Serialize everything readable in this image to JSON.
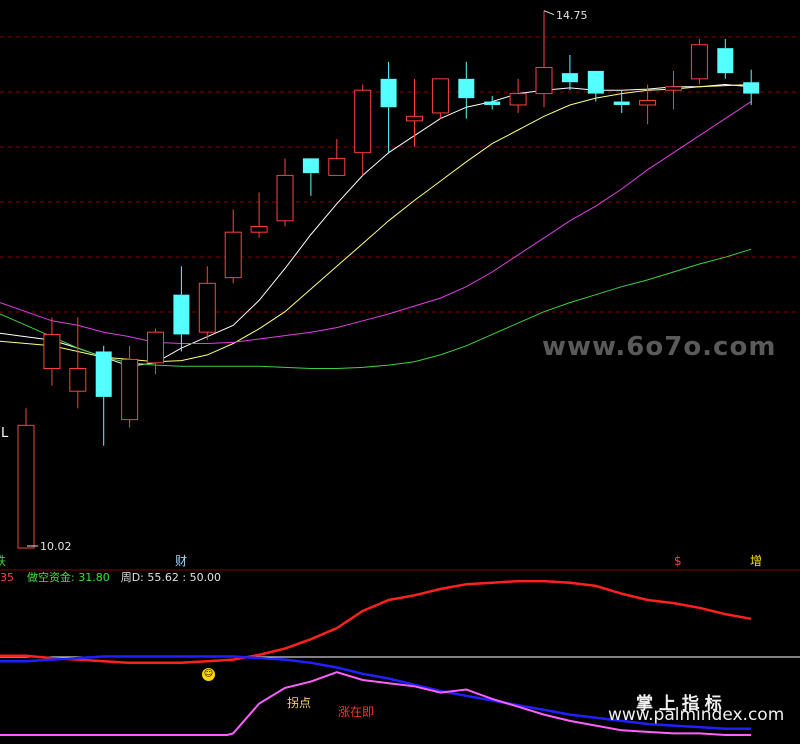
{
  "chart_data": {
    "type": "candlestick",
    "price_panel": {
      "high_label": "14.75",
      "low_label": "10.02",
      "candles": [
        {
          "o": 10.02,
          "h": 11.25,
          "l": 10.02,
          "c": 11.1,
          "color": "red"
        },
        {
          "o": 11.6,
          "h": 12.05,
          "l": 11.45,
          "c": 11.9,
          "color": "red"
        },
        {
          "o": 11.4,
          "h": 12.05,
          "l": 11.25,
          "c": 11.6,
          "color": "red"
        },
        {
          "o": 11.75,
          "h": 11.8,
          "l": 10.92,
          "c": 11.35,
          "color": "cyan"
        },
        {
          "o": 11.15,
          "h": 11.8,
          "l": 11.08,
          "c": 11.68,
          "color": "red"
        },
        {
          "o": 11.65,
          "h": 11.95,
          "l": 11.55,
          "c": 11.92,
          "color": "red"
        },
        {
          "o": 12.25,
          "h": 12.5,
          "l": 11.75,
          "c": 11.9,
          "color": "cyan"
        },
        {
          "o": 11.92,
          "h": 12.5,
          "l": 11.85,
          "c": 12.35,
          "color": "red"
        },
        {
          "o": 12.4,
          "h": 13.0,
          "l": 12.35,
          "c": 12.8,
          "color": "red"
        },
        {
          "o": 12.8,
          "h": 13.15,
          "l": 12.75,
          "c": 12.85,
          "color": "red"
        },
        {
          "o": 12.9,
          "h": 13.45,
          "l": 12.85,
          "c": 13.3,
          "color": "red"
        },
        {
          "o": 13.45,
          "h": 13.45,
          "l": 13.12,
          "c": 13.32,
          "color": "cyan"
        },
        {
          "o": 13.3,
          "h": 13.62,
          "l": 13.3,
          "c": 13.45,
          "color": "red"
        },
        {
          "o": 13.5,
          "h": 14.1,
          "l": 13.3,
          "c": 14.05,
          "color": "red"
        },
        {
          "o": 14.15,
          "h": 14.3,
          "l": 13.5,
          "c": 13.9,
          "color": "cyan"
        },
        {
          "o": 13.78,
          "h": 14.15,
          "l": 13.55,
          "c": 13.82,
          "color": "red"
        },
        {
          "o": 13.85,
          "h": 14.15,
          "l": 13.8,
          "c": 14.15,
          "color": "red"
        },
        {
          "o": 14.15,
          "h": 14.3,
          "l": 13.8,
          "c": 13.98,
          "color": "cyan"
        },
        {
          "o": 13.95,
          "h": 14.0,
          "l": 13.88,
          "c": 13.92,
          "color": "cyan"
        },
        {
          "o": 13.92,
          "h": 14.15,
          "l": 13.85,
          "c": 14.02,
          "color": "red"
        },
        {
          "o": 14.02,
          "h": 14.75,
          "l": 13.9,
          "c": 14.25,
          "color": "red"
        },
        {
          "o": 14.2,
          "h": 14.36,
          "l": 14.05,
          "c": 14.12,
          "color": "cyan"
        },
        {
          "o": 14.22,
          "h": 14.22,
          "l": 13.95,
          "c": 14.02,
          "color": "cyan"
        },
        {
          "o": 13.95,
          "h": 14.05,
          "l": 13.85,
          "c": 13.92,
          "color": "cyan"
        },
        {
          "o": 13.92,
          "h": 14.1,
          "l": 13.75,
          "c": 13.96,
          "color": "red"
        },
        {
          "o": 14.05,
          "h": 14.22,
          "l": 13.88,
          "c": 14.08,
          "color": "red"
        },
        {
          "o": 14.15,
          "h": 14.5,
          "l": 14.1,
          "c": 14.45,
          "color": "red"
        },
        {
          "o": 14.42,
          "h": 14.5,
          "l": 14.15,
          "c": 14.2,
          "color": "cyan"
        },
        {
          "o": 14.12,
          "h": 14.23,
          "l": 13.92,
          "c": 14.02,
          "color": "cyan"
        }
      ],
      "ma_series": [
        {
          "color": "#ffffff",
          "values": [
            11.88,
            11.85,
            11.78,
            11.7,
            11.62,
            11.65,
            11.78,
            11.88,
            11.98,
            12.2,
            12.48,
            12.78,
            13.05,
            13.3,
            13.5,
            13.65,
            13.8,
            13.9,
            13.95,
            14.02,
            14.05,
            14.07,
            14.05,
            14.05,
            14.06,
            14.08,
            14.08,
            14.1,
            14.08
          ]
        },
        {
          "color": "#ffff80",
          "values": [
            11.82,
            11.8,
            11.75,
            11.7,
            11.68,
            11.66,
            11.67,
            11.72,
            11.82,
            11.95,
            12.1,
            12.3,
            12.5,
            12.7,
            12.9,
            13.08,
            13.25,
            13.42,
            13.58,
            13.7,
            13.82,
            13.92,
            13.98,
            14.02,
            14.05,
            14.06,
            14.08,
            14.09,
            14.1
          ]
        },
        {
          "color": "#e040e0",
          "values": [
            12.1,
            12.02,
            11.98,
            11.92,
            11.88,
            11.83,
            11.82,
            11.82,
            11.83,
            11.86,
            11.89,
            11.92,
            11.96,
            12.02,
            12.08,
            12.15,
            12.22,
            12.32,
            12.45,
            12.6,
            12.75,
            12.9,
            13.03,
            13.18,
            13.35,
            13.5,
            13.65,
            13.8,
            13.95
          ]
        },
        {
          "color": "#40d040",
          "values": [
            11.98,
            11.88,
            11.78,
            11.7,
            11.65,
            11.63,
            11.62,
            11.62,
            11.62,
            11.62,
            11.61,
            11.6,
            11.6,
            11.61,
            11.63,
            11.66,
            11.72,
            11.8,
            11.9,
            12.0,
            12.1,
            12.18,
            12.25,
            12.32,
            12.38,
            12.45,
            12.52,
            12.58,
            12.65
          ]
        }
      ],
      "markers": [
        {
          "text": "L",
          "color": "#ffffff"
        },
        {
          "text": "财",
          "color": "#a0d8ff"
        },
        {
          "text": "$",
          "color": "#ff4040"
        },
        {
          "text": "增",
          "color": "#ffe000"
        }
      ]
    },
    "indicator_panel": {
      "header_prefix": "35",
      "series_label": "做空资金: 31.80",
      "week_label": "周D: 55.62 : 50.00",
      "red_line": [
        50.5,
        49,
        48,
        47,
        46,
        46,
        46,
        47,
        48,
        51,
        55,
        61,
        68,
        79,
        86,
        89,
        93,
        96,
        97,
        98,
        98,
        97,
        95,
        90,
        86,
        84,
        81,
        77,
        74
      ],
      "blue_line": [
        47,
        48,
        49,
        50,
        50,
        50,
        50,
        50,
        50,
        49,
        48,
        46,
        43,
        39,
        36,
        32,
        28,
        25,
        22,
        19,
        16,
        13,
        11,
        9,
        7,
        6,
        5,
        4,
        4
      ],
      "pink_line": [
        null,
        null,
        null,
        null,
        null,
        null,
        null,
        null,
        1,
        20,
        30,
        34,
        40,
        35,
        33,
        31,
        27,
        29,
        23,
        18,
        13,
        9,
        6,
        3,
        2,
        1,
        1,
        0,
        0
      ],
      "level_line": 52,
      "labels": [
        {
          "text": "拐点",
          "color": "#ffd070"
        },
        {
          "text": "涨在即",
          "color": "#ff3030"
        }
      ]
    }
  },
  "watermarks": {
    "site_name": "www.6o7o.com",
    "cn_label": "掌 上 指 标",
    "site_url": "www.palmindex.com"
  }
}
